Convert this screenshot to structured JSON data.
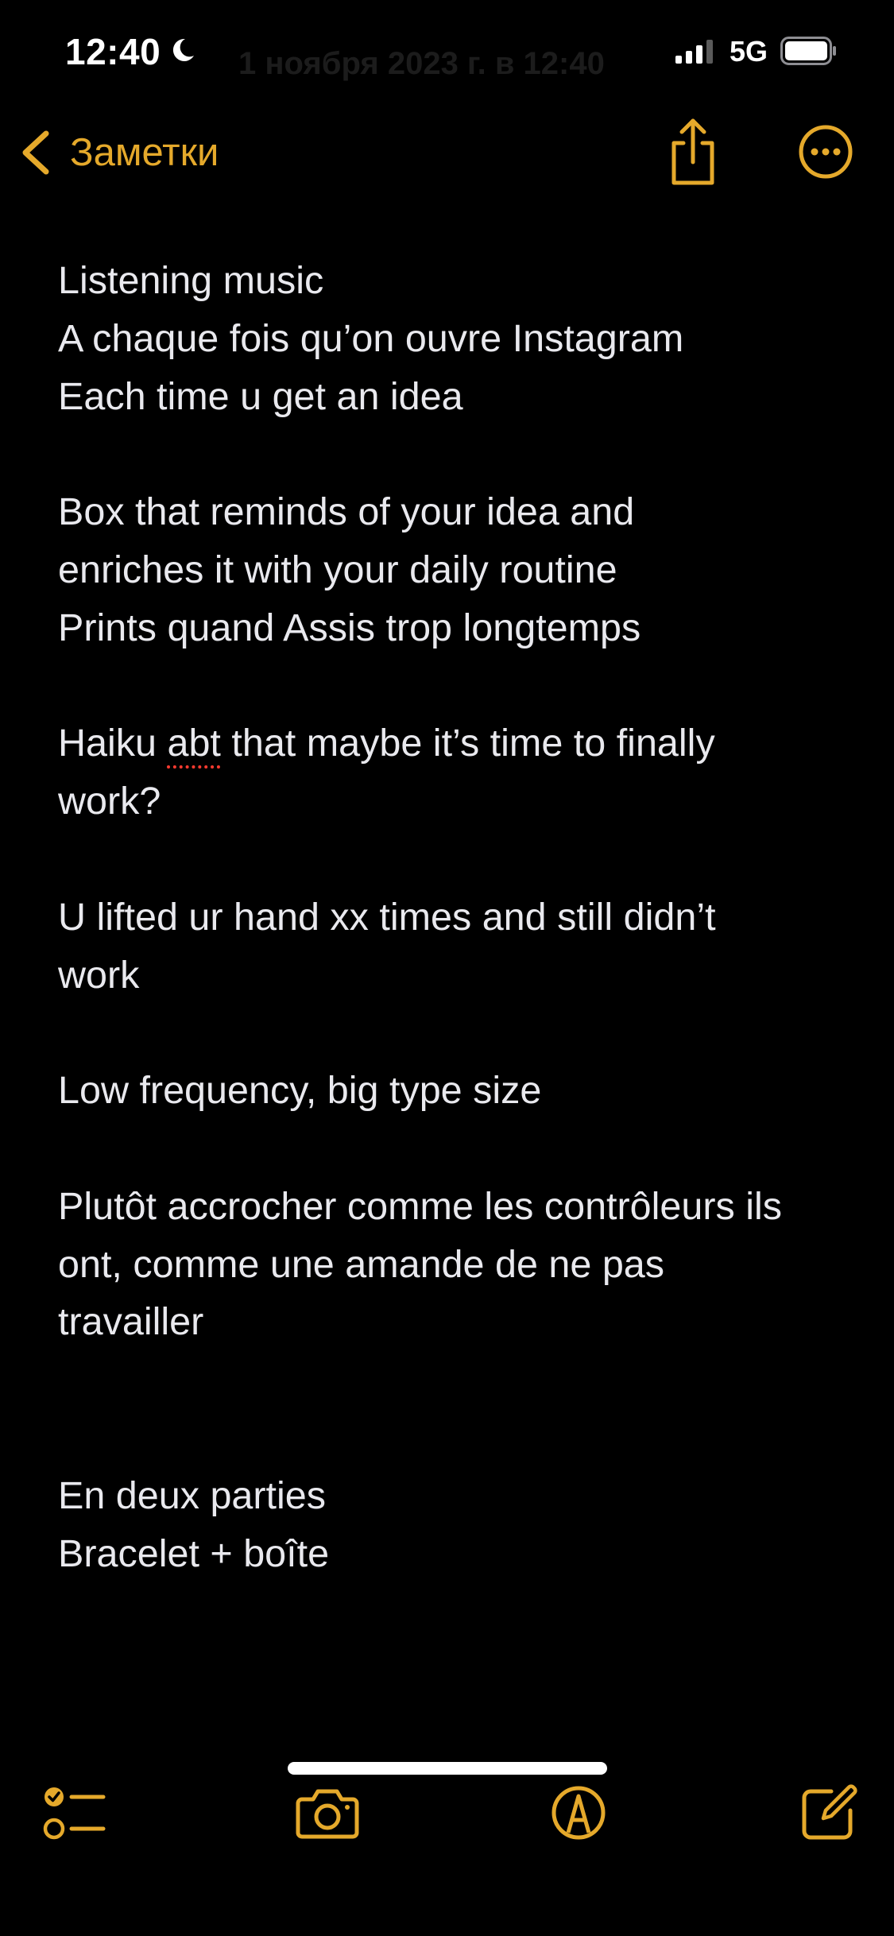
{
  "status_bar": {
    "time": "12:40",
    "faded_text": "1 ноября 2023 г. в 12:40",
    "network": "5G"
  },
  "nav": {
    "back_label": "Заметки"
  },
  "note": {
    "lines": [
      "Listening music",
      "A chaque fois qu’on ouvre Instagram",
      "Each time u get an idea",
      "",
      "Box that reminds of your idea and",
      "enriches it with your daily routine",
      "Prints quand Assis trop longtemps",
      "",
      "Haiku abt that maybe it’s time to finally",
      "work?",
      "",
      "U lifted ur hand xx times and still didn’t",
      "work",
      "",
      "Low frequency, big type size",
      "",
      "Plutôt accrocher comme les contrôleurs ils",
      "ont, comme une amande de ne pas",
      "travailler",
      "",
      "",
      "En deux parties",
      "Bracelet + boîte"
    ],
    "haiku_line_parts": {
      "before": "Haiku ",
      "misspelled": "abt",
      "after": " that maybe it’s time to finally"
    }
  },
  "colors": {
    "accent": "#e5a92b",
    "background": "#000000",
    "text": "#e9e9ee",
    "spellcheck": "#ff3b30"
  },
  "icons": {
    "back": "chevron-left-icon",
    "share": "share-icon",
    "more": "ellipsis-circle-icon",
    "checklist": "checklist-icon",
    "camera": "camera-icon",
    "markup": "markup-pen-icon",
    "compose": "compose-icon"
  }
}
